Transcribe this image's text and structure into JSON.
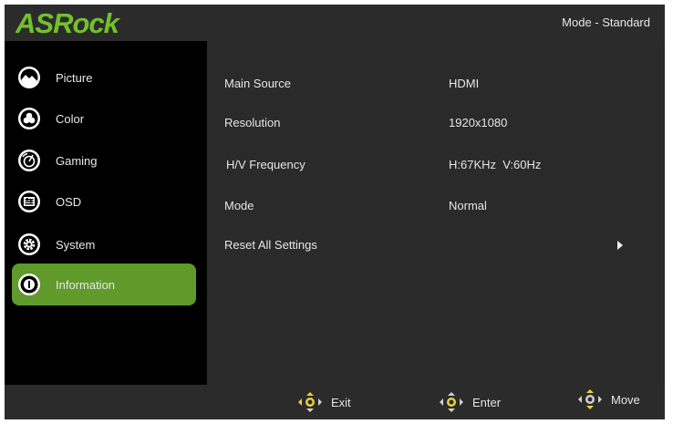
{
  "header": {
    "brand": "ASRock",
    "mode": "Mode - Standard"
  },
  "sidebar": {
    "items": [
      {
        "label": "Picture",
        "icon": "picture-icon"
      },
      {
        "label": "Color",
        "icon": "color-icon"
      },
      {
        "label": "Gaming",
        "icon": "gaming-icon"
      },
      {
        "label": "OSD",
        "icon": "osd-icon"
      },
      {
        "label": "System",
        "icon": "system-icon"
      },
      {
        "label": "Information",
        "icon": "information-icon",
        "active": true
      }
    ]
  },
  "info": {
    "rows": [
      {
        "label": "Main Source",
        "value": "HDMI"
      },
      {
        "label": "Resolution",
        "value": "1920x1080"
      },
      {
        "label": "H/V Frequency",
        "value": "H:67KHz  V:60Hz"
      },
      {
        "label": "Mode",
        "value": "Normal"
      },
      {
        "label": "Reset All Settings",
        "value": ""
      }
    ]
  },
  "footer": {
    "exit": "Exit",
    "enter": "Enter",
    "move": "Move"
  },
  "colors": {
    "accent_green": "#5f9a2b",
    "logo_green": "#72c02c",
    "key_yellow": "#e8d23c"
  }
}
